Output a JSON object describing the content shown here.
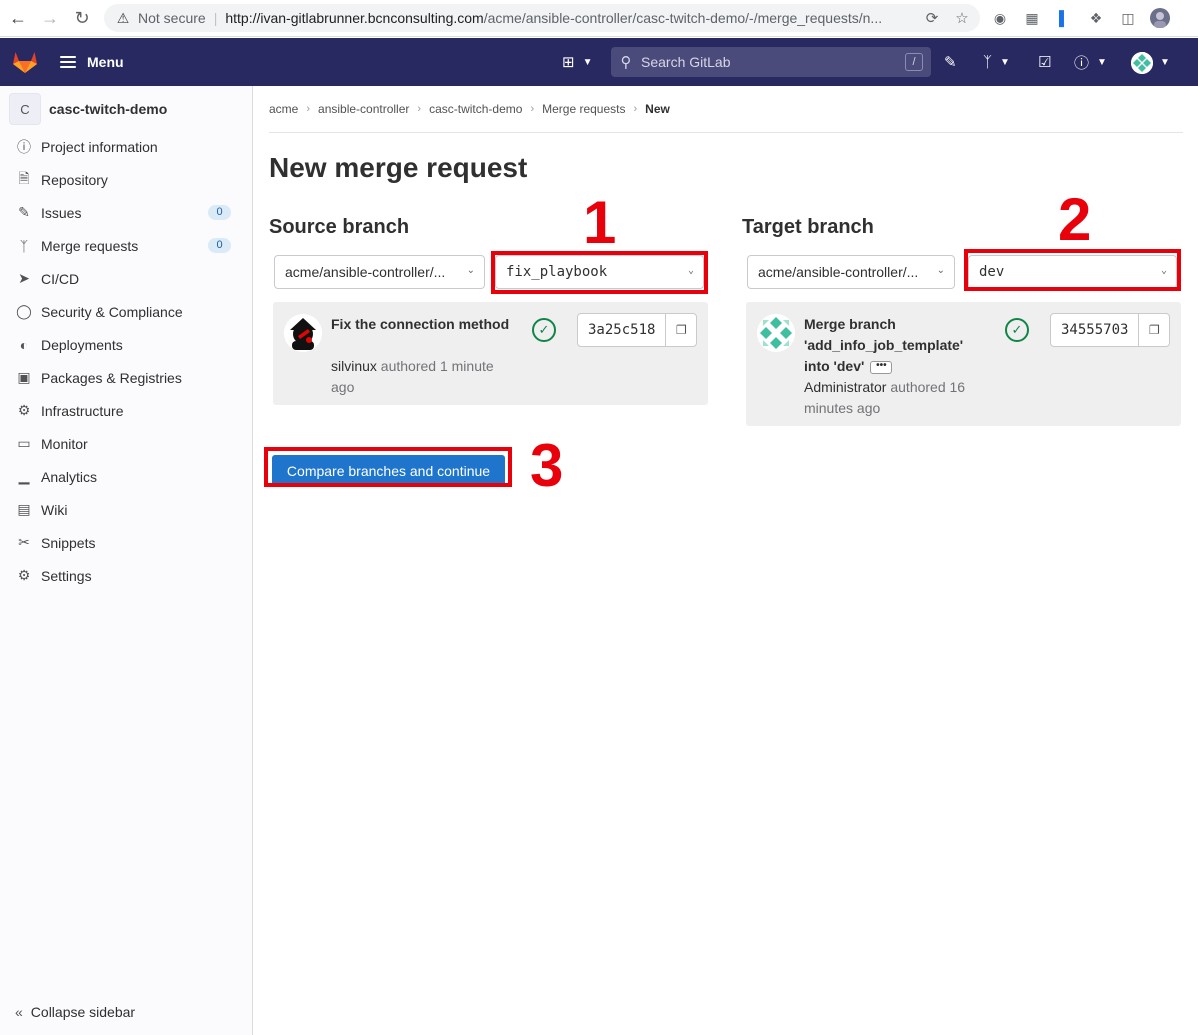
{
  "browser": {
    "security_label": "Not secure",
    "url_host": "http://ivan-gitlabrunner.bcnconsulting.com",
    "url_path": "/acme/ansible-controller/casc-twitch-demo/-/merge_requests/n..."
  },
  "topbar": {
    "menu_label": "Menu",
    "search_placeholder": "Search GitLab",
    "search_shortcut": "/"
  },
  "sidebar": {
    "project_initial": "C",
    "project_name": "casc-twitch-demo",
    "items": [
      {
        "label": "Project information",
        "icon": "info-icon"
      },
      {
        "label": "Repository",
        "icon": "doc-icon"
      },
      {
        "label": "Issues",
        "icon": "issues-icon",
        "count": "0"
      },
      {
        "label": "Merge requests",
        "icon": "merge-request-icon",
        "count": "0"
      },
      {
        "label": "CI/CD",
        "icon": "rocket-icon"
      },
      {
        "label": "Security & Compliance",
        "icon": "shield-icon"
      },
      {
        "label": "Deployments",
        "icon": "deployments-icon"
      },
      {
        "label": "Packages & Registries",
        "icon": "package-icon"
      },
      {
        "label": "Infrastructure",
        "icon": "cloud-gear-icon"
      },
      {
        "label": "Monitor",
        "icon": "monitor-icon"
      },
      {
        "label": "Analytics",
        "icon": "chart-icon"
      },
      {
        "label": "Wiki",
        "icon": "book-icon"
      },
      {
        "label": "Snippets",
        "icon": "scissors-icon"
      },
      {
        "label": "Settings",
        "icon": "settings-icon"
      }
    ],
    "collapse_label": "Collapse sidebar"
  },
  "breadcrumb": {
    "items": [
      "acme",
      "ansible-controller",
      "casc-twitch-demo",
      "Merge requests"
    ],
    "current": "New"
  },
  "page": {
    "title": "New merge request",
    "compare_button": "Compare branches and continue"
  },
  "source": {
    "heading": "Source branch",
    "project": "acme/ansible-controller/...",
    "branch": "fix_playbook",
    "commit_title": "Fix the connection method",
    "author": "silvinux",
    "authored_text": "authored 1 minute ago",
    "sha": "3a25c518"
  },
  "target": {
    "heading": "Target branch",
    "project": "acme/ansible-controller/...",
    "branch": "dev",
    "commit_title": "Merge branch 'add_info_job_template' into 'dev'",
    "author": "Administrator",
    "authored_text": "authored 16 minutes ago",
    "sha": "34555703"
  },
  "annotations": {
    "one": "1",
    "two": "2",
    "three": "3",
    "color": "#e8000b"
  },
  "colors": {
    "topbar": "#292961",
    "primary_button": "#1f75cb",
    "success": "#108548"
  }
}
